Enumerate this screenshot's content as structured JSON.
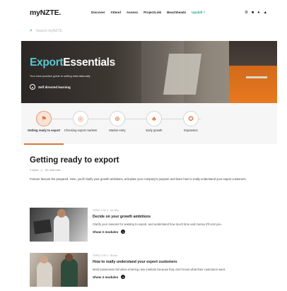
{
  "brand": {
    "logo_text": "myNZTE."
  },
  "nav": {
    "items": [
      "Discover",
      "Attend",
      "Assess",
      "ProjectLink",
      "Beachheads"
    ],
    "upskill": "Upskill ˅",
    "icons": [
      "settings-icon",
      "bookmark-icon",
      "notification-icon",
      "profile-icon"
    ]
  },
  "search": {
    "placeholder": "Search myNZTE"
  },
  "hero": {
    "title_accent": "Export",
    "title_rest": "Essentials",
    "subtitle": "Your best practice guide to selling internationally",
    "badge": "Self directed learning"
  },
  "steps": [
    {
      "label": "Getting ready to export",
      "icon": "rocket-icon",
      "glyph": "⚑",
      "active": true
    },
    {
      "label": "Choosing export markets",
      "icon": "globe-pin-icon",
      "glyph": "◎",
      "active": false
    },
    {
      "label": "Market entry",
      "icon": "globe-icon",
      "glyph": "⊕",
      "active": false
    },
    {
      "label": "Early growth",
      "icon": "plant-icon",
      "glyph": "♣",
      "active": false
    },
    {
      "label": "Expansion",
      "icon": "award-icon",
      "glyph": "✪",
      "active": false
    }
  ],
  "section": {
    "title": "Getting ready to export",
    "meta_topics": "2 topics",
    "meta_time": "2hr 4min total",
    "intro": "Fortune favours the prepared. Here, you'll clarify your growth ambitions, articulate your company's purpose and learn how to really understand your export customers."
  },
  "cards": [
    {
      "meta": "TOPIC 1 OF 2 · 1hr 30m",
      "title": "Decide on your growth ambitions",
      "desc": "Clarify your reasons for wanting to export, and understand how much time and money it'll cost you.",
      "button": "Show 2 modules"
    },
    {
      "meta": "TOPIC 2 OF 2 · 34 min",
      "title": "How to really understand your export customers",
      "desc": "Most businesses fail when entering new markets because they don't know what their customers want.",
      "button": "Show 3 modules"
    }
  ],
  "colors": {
    "accent_teal": "#56c7cf",
    "accent_orange": "#e0733b",
    "upskill_green": "#1aa38a"
  }
}
